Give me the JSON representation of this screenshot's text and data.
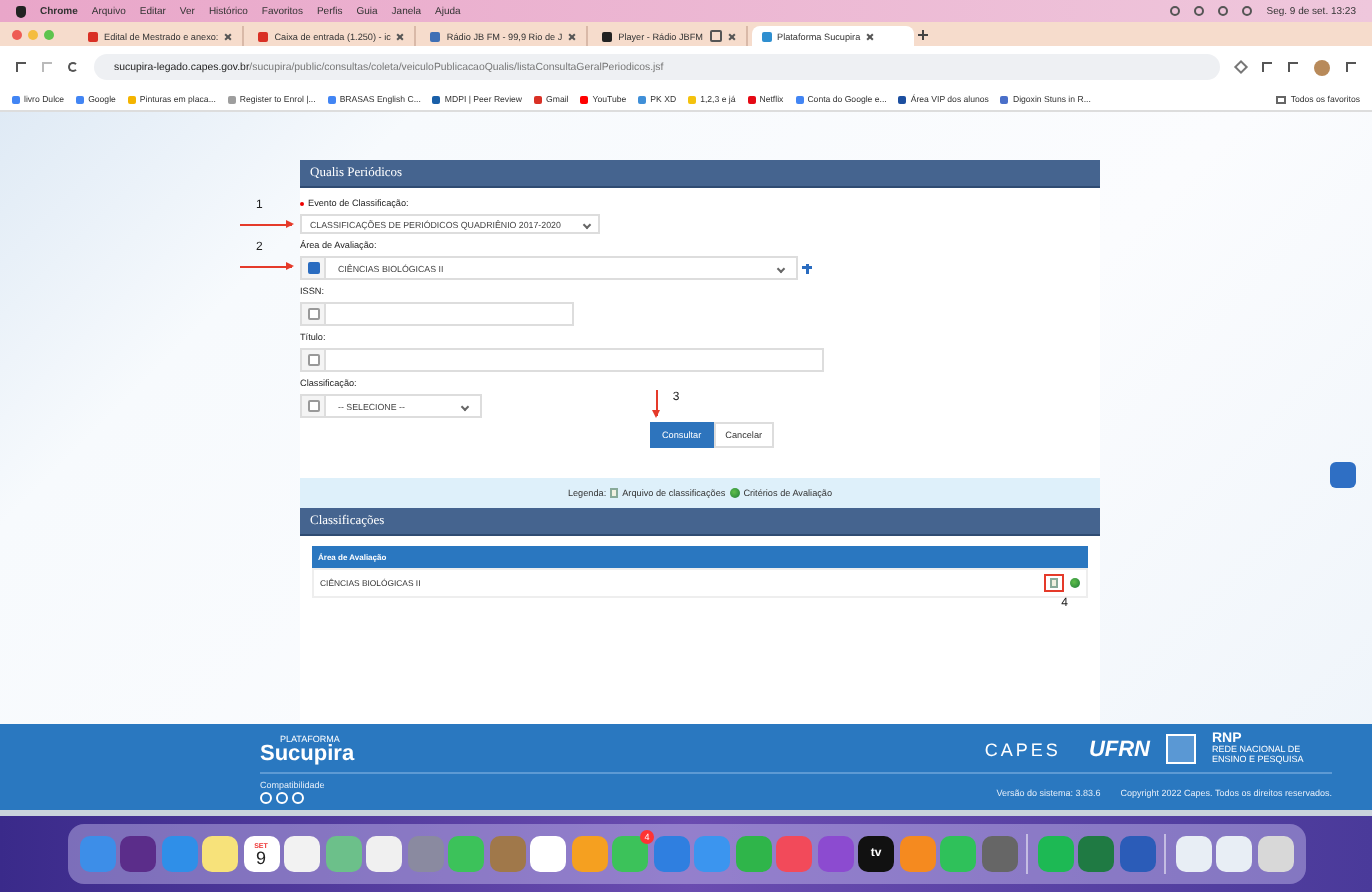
{
  "menu_bar": {
    "app": "Chrome",
    "items": [
      "Arquivo",
      "Editar",
      "Ver",
      "Histórico",
      "Favoritos",
      "Perfis",
      "Guia",
      "Janela",
      "Ajuda"
    ],
    "clock": "Seg. 9 de set. 13:23"
  },
  "tabs": [
    {
      "title": "Edital de Mestrado e anexo:",
      "kind": "mail",
      "selected": false
    },
    {
      "title": "Caixa de entrada (1.250) - ic",
      "kind": "mail",
      "selected": false
    },
    {
      "title": "Rádio JB FM - 99,9 Rio de J",
      "kind": "radio",
      "selected": false
    },
    {
      "title": "Player - Rádio JBFM",
      "kind": "player",
      "selected": false
    },
    {
      "title": "Plataforma Sucupira",
      "kind": "sucupira",
      "selected": true
    }
  ],
  "address": {
    "domain": "sucupira-legado.capes.gov.br",
    "path": "/sucupira/public/consultas/coleta/veiculoPublicacaoQualis/listaConsultaGeralPeriodicos.jsf"
  },
  "bookmarks": [
    {
      "label": "livro Dulce",
      "color": "#4285f4"
    },
    {
      "label": "Google",
      "color": "#4285f4"
    },
    {
      "label": "Pinturas em placa...",
      "color": "#f4b400"
    },
    {
      "label": "Register to Enrol |...",
      "color": "#9e9e9e"
    },
    {
      "label": "BRASAS English C...",
      "color": "#4285f4"
    },
    {
      "label": "MDPI | Peer Review",
      "color": "#1a5fa8"
    },
    {
      "label": "Gmail",
      "color": "#d93025"
    },
    {
      "label": "YouTube",
      "color": "#ff0000"
    },
    {
      "label": "PK XD",
      "color": "#3f8fd8"
    },
    {
      "label": "1,2,3 e já",
      "color": "#f4c20d"
    },
    {
      "label": "Netflix",
      "color": "#e50914"
    },
    {
      "label": "Conta do Google e...",
      "color": "#4285f4"
    },
    {
      "label": "Área VIP dos alunos",
      "color": "#1c4fa0"
    },
    {
      "label": "Digoxin Stuns in R...",
      "color": "#4a6fc9"
    }
  ],
  "all_bookmarks": "Todos os favoritos",
  "panel": {
    "title": "Qualis Periódicos"
  },
  "fields": [
    {
      "kind": "select",
      "label": "Evento de Classificação:",
      "required": true,
      "value": "CLASSIFICAÇÕES DE PERIÓDICOS QUADRIÊNIO 2017-2020",
      "marker": "1"
    },
    {
      "kind": "check-select",
      "label": "Área de Avaliação:",
      "checked": true,
      "value": "CIÊNCIAS BIOLÓGICAS II",
      "marker": "2"
    },
    {
      "kind": "check-input-short",
      "label": "ISSN:",
      "checked": false
    },
    {
      "kind": "check-input-long",
      "label": "Título:",
      "checked": false
    },
    {
      "kind": "check-small-select",
      "label": "Classificação:",
      "checked": false,
      "value": "-- SELECIONE --"
    }
  ],
  "buttons": [
    {
      "label": "Consultar",
      "kind": "primary"
    },
    {
      "label": "Cancelar",
      "kind": "default"
    }
  ],
  "button_marker": "3",
  "legend": {
    "label": "Legenda:",
    "file": "Arquivo de classificações",
    "criteria": "Critérios de Avaliação"
  },
  "results": {
    "title": "Classificações",
    "column": "Área de Avaliação",
    "rows": [
      {
        "area": "CIÊNCIAS BIOLÓGICAS II"
      }
    ],
    "marker": "4"
  },
  "footer": {
    "logo_small": "PLATAFORMA",
    "logo": "Sucupira",
    "capes": "CAPES",
    "ufrn": "UFRN",
    "rnp": "RNP",
    "rnp_sub": "REDE NACIONAL DE ENSINO E PESQUISA",
    "compat": "Compatibilidade",
    "version": "Versão do sistema: 3.83.6",
    "copyright": "Copyright 2022 Capes. Todos os direitos reservados."
  },
  "dock": [
    {
      "color": "#3d8ee8"
    },
    {
      "color": "#5b2d8a"
    },
    {
      "color": "#2f8fe8"
    },
    {
      "color": "#f7e27a"
    },
    {
      "color": "#ffffff",
      "label": "SET",
      "sub": "9"
    },
    {
      "color": "#f2f2f2"
    },
    {
      "color": "#6cc08a"
    },
    {
      "color": "#f0f0f0"
    },
    {
      "color": "#8a8aa0"
    },
    {
      "color": "#3cc25a"
    },
    {
      "color": "#a0784a"
    },
    {
      "color": "#ffffff"
    },
    {
      "color": "#f5a020"
    },
    {
      "color": "#3cc25a",
      "badge": "4"
    },
    {
      "color": "#2f7fe0"
    },
    {
      "color": "#3b95ef"
    },
    {
      "color": "#2fb54a"
    },
    {
      "color": "#f24a5a"
    },
    {
      "color": "#8c4bd0"
    },
    {
      "color": "#111111",
      "label": "tv"
    },
    {
      "color": "#f58a1f"
    },
    {
      "color": "#2fc15a"
    },
    {
      "color": "#666666"
    },
    {
      "color": "#1db954"
    },
    {
      "color": "#1f7a43"
    },
    {
      "color": "#2b5cb8"
    },
    {
      "color": "#e8eef5"
    },
    {
      "color": "#e8eef5"
    },
    {
      "color": "#d8d8d8"
    }
  ]
}
